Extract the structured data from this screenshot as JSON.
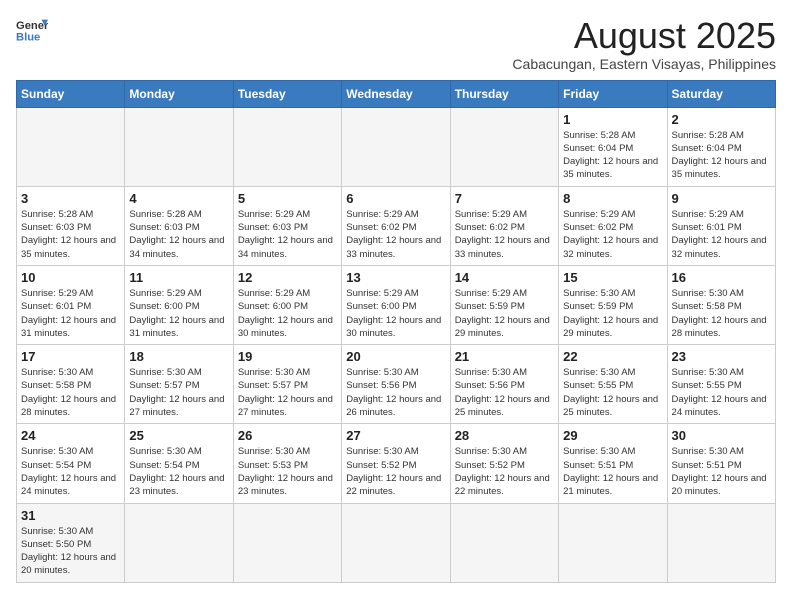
{
  "header": {
    "logo_general": "General",
    "logo_blue": "Blue",
    "title": "August 2025",
    "subtitle": "Cabacungan, Eastern Visayas, Philippines"
  },
  "days_of_week": [
    "Sunday",
    "Monday",
    "Tuesday",
    "Wednesday",
    "Thursday",
    "Friday",
    "Saturday"
  ],
  "weeks": [
    {
      "cells": [
        {
          "day": "",
          "info": ""
        },
        {
          "day": "",
          "info": ""
        },
        {
          "day": "",
          "info": ""
        },
        {
          "day": "",
          "info": ""
        },
        {
          "day": "",
          "info": ""
        },
        {
          "day": "1",
          "info": "Sunrise: 5:28 AM\nSunset: 6:04 PM\nDaylight: 12 hours\nand 35 minutes."
        },
        {
          "day": "2",
          "info": "Sunrise: 5:28 AM\nSunset: 6:04 PM\nDaylight: 12 hours\nand 35 minutes."
        }
      ]
    },
    {
      "cells": [
        {
          "day": "3",
          "info": "Sunrise: 5:28 AM\nSunset: 6:03 PM\nDaylight: 12 hours\nand 35 minutes."
        },
        {
          "day": "4",
          "info": "Sunrise: 5:28 AM\nSunset: 6:03 PM\nDaylight: 12 hours\nand 34 minutes."
        },
        {
          "day": "5",
          "info": "Sunrise: 5:29 AM\nSunset: 6:03 PM\nDaylight: 12 hours\nand 34 minutes."
        },
        {
          "day": "6",
          "info": "Sunrise: 5:29 AM\nSunset: 6:02 PM\nDaylight: 12 hours\nand 33 minutes."
        },
        {
          "day": "7",
          "info": "Sunrise: 5:29 AM\nSunset: 6:02 PM\nDaylight: 12 hours\nand 33 minutes."
        },
        {
          "day": "8",
          "info": "Sunrise: 5:29 AM\nSunset: 6:02 PM\nDaylight: 12 hours\nand 32 minutes."
        },
        {
          "day": "9",
          "info": "Sunrise: 5:29 AM\nSunset: 6:01 PM\nDaylight: 12 hours\nand 32 minutes."
        }
      ]
    },
    {
      "cells": [
        {
          "day": "10",
          "info": "Sunrise: 5:29 AM\nSunset: 6:01 PM\nDaylight: 12 hours\nand 31 minutes."
        },
        {
          "day": "11",
          "info": "Sunrise: 5:29 AM\nSunset: 6:00 PM\nDaylight: 12 hours\nand 31 minutes."
        },
        {
          "day": "12",
          "info": "Sunrise: 5:29 AM\nSunset: 6:00 PM\nDaylight: 12 hours\nand 30 minutes."
        },
        {
          "day": "13",
          "info": "Sunrise: 5:29 AM\nSunset: 6:00 PM\nDaylight: 12 hours\nand 30 minutes."
        },
        {
          "day": "14",
          "info": "Sunrise: 5:29 AM\nSunset: 5:59 PM\nDaylight: 12 hours\nand 29 minutes."
        },
        {
          "day": "15",
          "info": "Sunrise: 5:30 AM\nSunset: 5:59 PM\nDaylight: 12 hours\nand 29 minutes."
        },
        {
          "day": "16",
          "info": "Sunrise: 5:30 AM\nSunset: 5:58 PM\nDaylight: 12 hours\nand 28 minutes."
        }
      ]
    },
    {
      "cells": [
        {
          "day": "17",
          "info": "Sunrise: 5:30 AM\nSunset: 5:58 PM\nDaylight: 12 hours\nand 28 minutes."
        },
        {
          "day": "18",
          "info": "Sunrise: 5:30 AM\nSunset: 5:57 PM\nDaylight: 12 hours\nand 27 minutes."
        },
        {
          "day": "19",
          "info": "Sunrise: 5:30 AM\nSunset: 5:57 PM\nDaylight: 12 hours\nand 27 minutes."
        },
        {
          "day": "20",
          "info": "Sunrise: 5:30 AM\nSunset: 5:56 PM\nDaylight: 12 hours\nand 26 minutes."
        },
        {
          "day": "21",
          "info": "Sunrise: 5:30 AM\nSunset: 5:56 PM\nDaylight: 12 hours\nand 25 minutes."
        },
        {
          "day": "22",
          "info": "Sunrise: 5:30 AM\nSunset: 5:55 PM\nDaylight: 12 hours\nand 25 minutes."
        },
        {
          "day": "23",
          "info": "Sunrise: 5:30 AM\nSunset: 5:55 PM\nDaylight: 12 hours\nand 24 minutes."
        }
      ]
    },
    {
      "cells": [
        {
          "day": "24",
          "info": "Sunrise: 5:30 AM\nSunset: 5:54 PM\nDaylight: 12 hours\nand 24 minutes."
        },
        {
          "day": "25",
          "info": "Sunrise: 5:30 AM\nSunset: 5:54 PM\nDaylight: 12 hours\nand 23 minutes."
        },
        {
          "day": "26",
          "info": "Sunrise: 5:30 AM\nSunset: 5:53 PM\nDaylight: 12 hours\nand 23 minutes."
        },
        {
          "day": "27",
          "info": "Sunrise: 5:30 AM\nSunset: 5:52 PM\nDaylight: 12 hours\nand 22 minutes."
        },
        {
          "day": "28",
          "info": "Sunrise: 5:30 AM\nSunset: 5:52 PM\nDaylight: 12 hours\nand 22 minutes."
        },
        {
          "day": "29",
          "info": "Sunrise: 5:30 AM\nSunset: 5:51 PM\nDaylight: 12 hours\nand 21 minutes."
        },
        {
          "day": "30",
          "info": "Sunrise: 5:30 AM\nSunset: 5:51 PM\nDaylight: 12 hours\nand 20 minutes."
        }
      ]
    },
    {
      "cells": [
        {
          "day": "31",
          "info": "Sunrise: 5:30 AM\nSunset: 5:50 PM\nDaylight: 12 hours\nand 20 minutes."
        },
        {
          "day": "",
          "info": ""
        },
        {
          "day": "",
          "info": ""
        },
        {
          "day": "",
          "info": ""
        },
        {
          "day": "",
          "info": ""
        },
        {
          "day": "",
          "info": ""
        },
        {
          "day": "",
          "info": ""
        }
      ]
    }
  ]
}
